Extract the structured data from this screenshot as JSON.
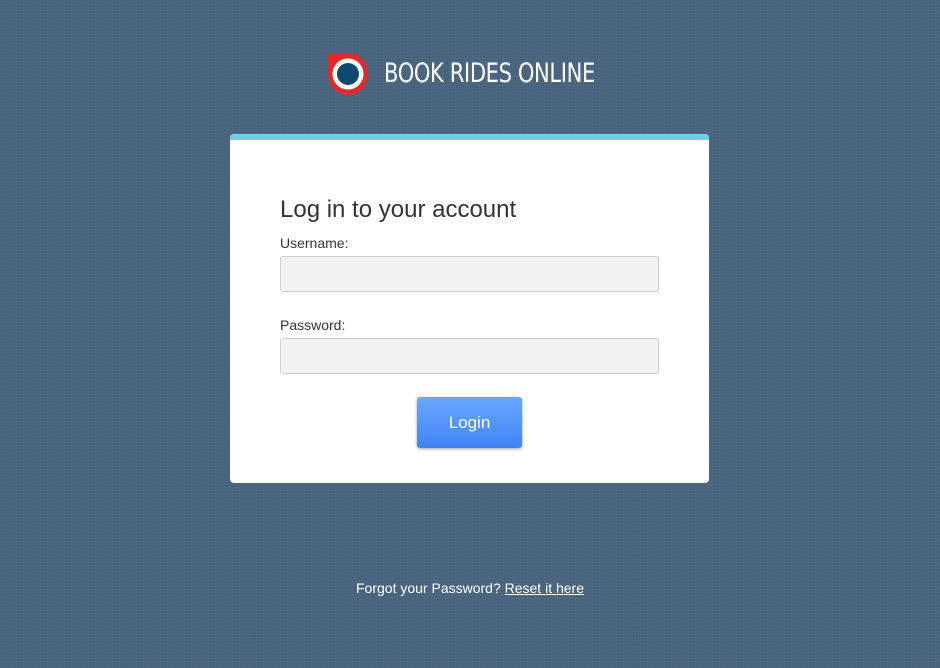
{
  "brand": {
    "name": "BOOK RIDES ONLINE",
    "logo_icon": "roundel-logo-icon",
    "colors": {
      "logo_red": "#e32a2a",
      "logo_navy": "#0d4a6b",
      "background": "#4a6580",
      "accent": "#6fcfe3",
      "button": "#4a8ef9"
    }
  },
  "login": {
    "title": "Log in to your account",
    "username_label": "Username:",
    "username_value": "",
    "password_label": "Password:",
    "password_value": "",
    "submit_label": "Login"
  },
  "footer": {
    "forgot_text": "Forgot your Password?",
    "reset_link": "Reset it here"
  }
}
